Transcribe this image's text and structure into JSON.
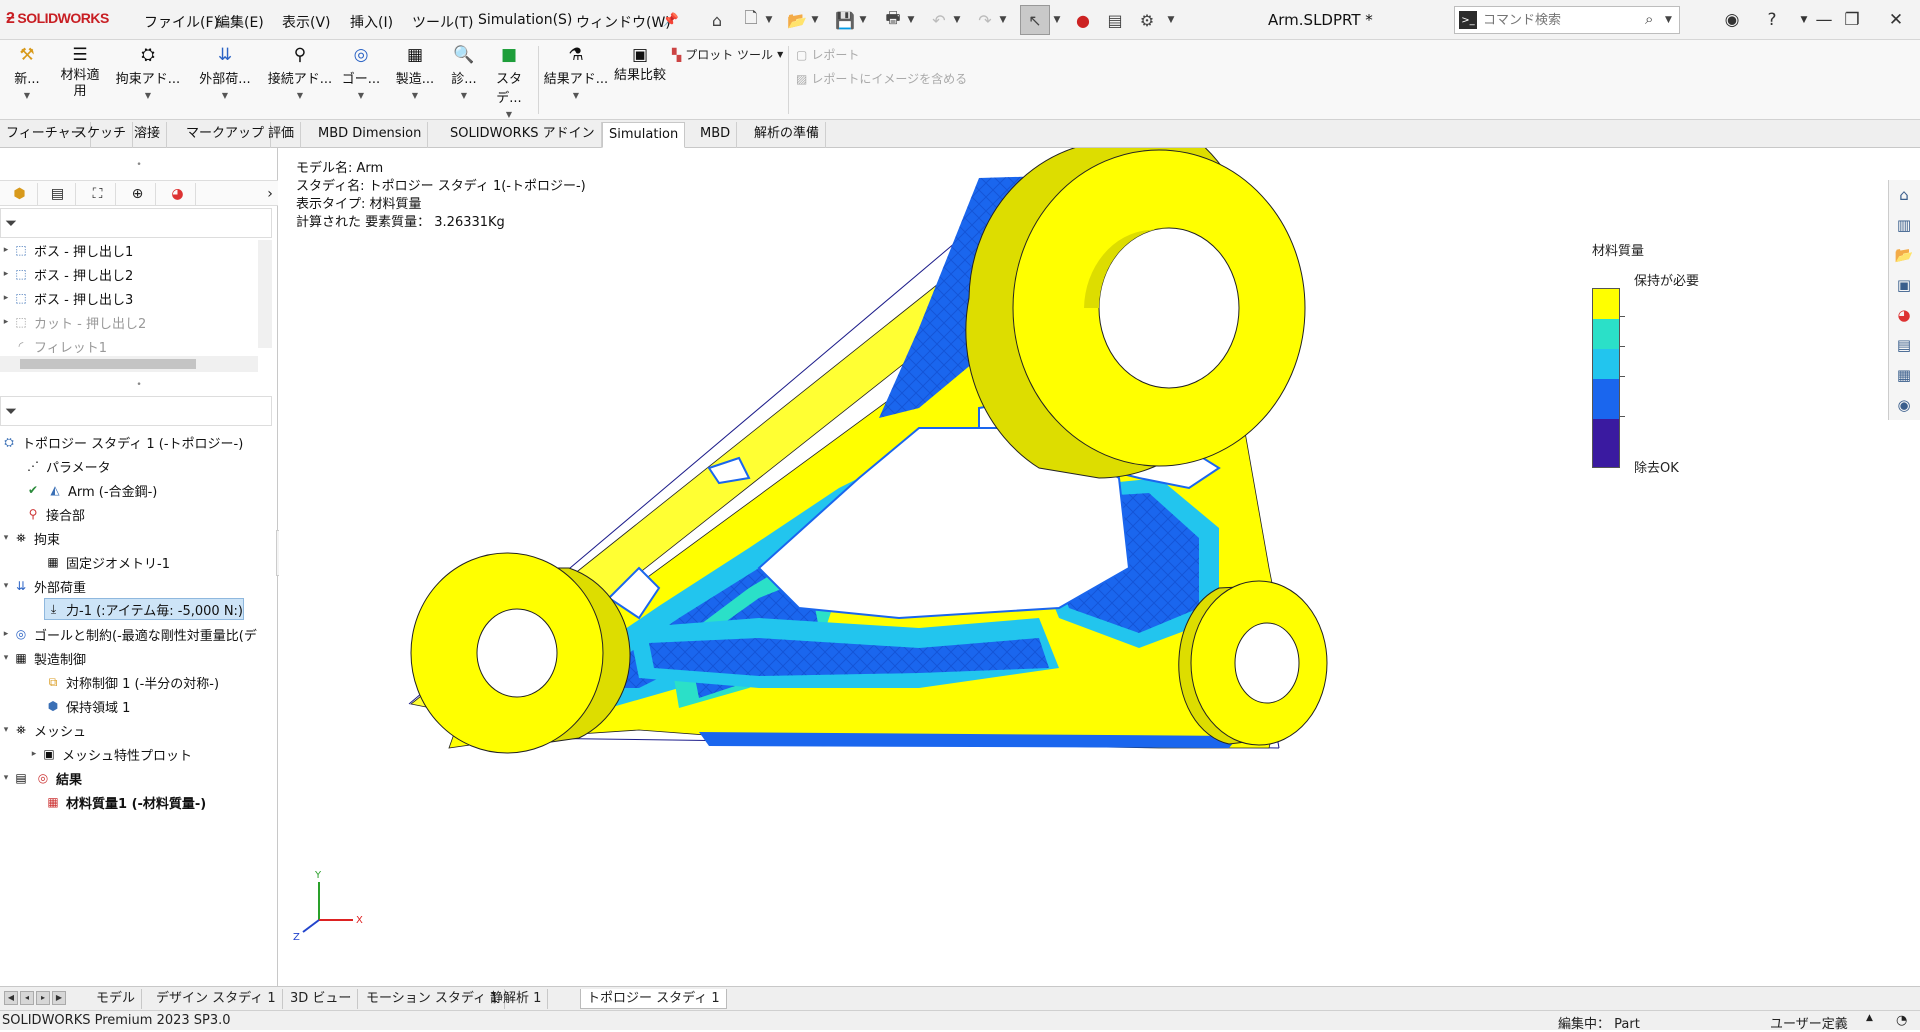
{
  "app": {
    "logo_text": "SOLIDWORKS",
    "document_title": "Arm.SLDPRT *"
  },
  "menu": [
    "ファイル(F)",
    "編集(E)",
    "表示(V)",
    "挿入(I)",
    "ツール(T)",
    "Simulation(S)",
    "ウィンドウ(W)"
  ],
  "command_search": {
    "placeholder": "コマンド検索"
  },
  "ribbon": {
    "new": "新...",
    "apply_material": "材料適用",
    "fixtures": "拘束アド...",
    "external_loads": "外部荷...",
    "connections": "接続アド...",
    "goals": "ゴー...",
    "manufacturing": "製造...",
    "diagnostics": "診...",
    "study": "スタデ...",
    "results_advisor": "結果アド...",
    "compare_results": "結果比較",
    "plot_tools": "プロット ツール",
    "report": "レポート",
    "include_image": "レポートにイメージを含める"
  },
  "tabs": [
    "フィーチャー",
    "スケッチ",
    "溶接",
    "マークアップ",
    "評価",
    "MBD Dimension",
    "SOLIDWORKS アドイン",
    "Simulation",
    "MBD",
    "解析の準備"
  ],
  "active_tab": "Simulation",
  "feature_tree": [
    {
      "label": "ボス - 押し出し1",
      "icon": "boss-extrude-icon"
    },
    {
      "label": "ボス - 押し出し2",
      "icon": "boss-extrude-icon"
    },
    {
      "label": "ボス - 押し出し3",
      "icon": "boss-extrude-icon"
    },
    {
      "label": "カット - 押し出し2",
      "icon": "cut-extrude-icon"
    },
    {
      "label": "フィレット1",
      "icon": "fillet-icon"
    }
  ],
  "study_tree": {
    "study": "トポロジー スタディ 1 (-トポロジー-)",
    "parameters": "パラメータ",
    "part": "Arm (-合金鋼-)",
    "connections": "接合部",
    "fixtures": "拘束",
    "fixed_geometry": "固定ジオメトリ-1",
    "external_loads": "外部荷重",
    "force": "力-1 (:アイテム毎: -5,000 N:)",
    "goals": "ゴールと制約(-最適な剛性対重量比(デ",
    "manufacturing": "製造制御",
    "symmetry": "対称制御 1 (-半分の対称-)",
    "preserved_region": "保持領域 1",
    "mesh": "メッシュ",
    "mesh_plot": "メッシュ特性プロット",
    "results": "結果",
    "material_mass": "材料質量1 (-材料質量-)"
  },
  "viewport_info": {
    "model_name": "モデル名: Arm",
    "study_name": "スタディ名: トポロジー スタディ 1(-トポロジー-)",
    "plot_type": "表示タイプ: 材料質量",
    "computed_mass": "計算された 要素質量： 3.26331Kg"
  },
  "legend": {
    "title": "材料質量",
    "high_label": "保持が必要",
    "low_label": "除去OK",
    "colors": [
      "#ffff00",
      "#2be0c8",
      "#22c5ee",
      "#1a66ee",
      "#3a1aa0"
    ]
  },
  "bottom_tabs": [
    "モデル",
    "デザイン スタディ 1",
    "3D ビュー",
    "モーション スタディ 1",
    "静解析 1",
    "トポロジー スタディ 1"
  ],
  "active_bottom_tab": "トポロジー スタディ 1",
  "status": {
    "product": "SOLIDWORKS Premium 2023 SP3.0",
    "editing": "編集中： Part",
    "units": "ユーザー定義"
  },
  "triad_labels": {
    "x": "X",
    "y": "Y",
    "z": "Z"
  }
}
